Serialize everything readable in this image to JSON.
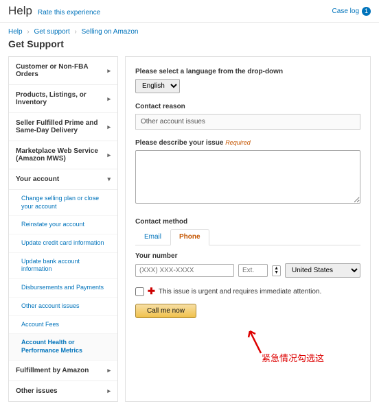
{
  "header": {
    "title": "Help",
    "rate": "Rate this experience",
    "caselog": "Case log",
    "caselog_count": "1"
  },
  "breadcrumb": {
    "a": "Help",
    "b": "Get support",
    "c": "Selling on Amazon"
  },
  "page_title": "Get Support",
  "sidebar": {
    "items": [
      "Customer or Non-FBA Orders",
      "Products, Listings, or Inventory",
      "Seller Fulfilled Prime and Same-Day Delivery",
      "Marketplace Web Service (Amazon MWS)",
      "Your account",
      "Fulfillment by Amazon",
      "Other issues"
    ],
    "subs": [
      "Change selling plan or close your account",
      "Reinstate your account",
      "Update credit card information",
      "Update bank account information",
      "Disbursements and Payments",
      "Other account issues",
      "Account Fees",
      "Account Health or Performance Metrics"
    ]
  },
  "main": {
    "lang_label": "Please select a language from the drop-down",
    "lang_value": "English",
    "reason_label": "Contact reason",
    "reason_value": "Other account issues",
    "describe_label": "Please describe your issue",
    "required": "Required",
    "method_label": "Contact method",
    "tab_email": "Email",
    "tab_phone": "Phone",
    "number_label": "Your number",
    "number_placeholder": "(XXX) XXX-XXXX",
    "ext_placeholder": "Ext.",
    "country": "United States",
    "urgent": "This issue is urgent and requires immediate attention.",
    "call_btn": "Call me now"
  },
  "annotation": "紧急情况勾选这"
}
